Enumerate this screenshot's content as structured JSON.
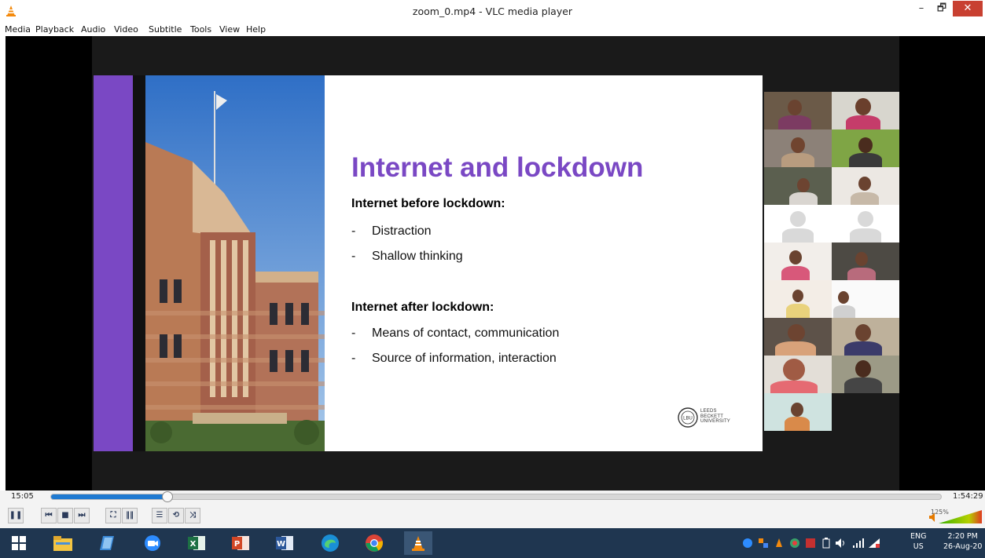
{
  "window": {
    "title": "zoom_0.mp4 - VLC media player",
    "minimize": "–",
    "restore": "🗗",
    "close": "✕"
  },
  "menu": [
    "Media",
    "Playback",
    "Audio",
    "Video",
    "Subtitle",
    "Tools",
    "View",
    "Help"
  ],
  "slide": {
    "heading": "Internet and lockdown",
    "before_title": "Internet before lockdown:",
    "before_items": [
      "Distraction",
      "Shallow thinking"
    ],
    "after_title": "Internet after lockdown:",
    "after_items": [
      "Means of contact, communication",
      "Source of information, interaction"
    ],
    "bullet_dash": "-",
    "logo_lines": [
      "LEEDS",
      "BECKETT",
      "UNIVERSITY"
    ],
    "logo_mark": "LBU"
  },
  "playback": {
    "current_time": "15:05",
    "total_time": "1:54:29",
    "progress": 0.131,
    "volume_label": "125%"
  },
  "controls": {
    "pause": "❚❚",
    "prev": "⏮",
    "stop": "■",
    "next": "⏭",
    "fullscreen": "⛶",
    "extended": "‖‖",
    "playlist": "☰",
    "loop": "⟲",
    "shuffle": "⤨"
  },
  "taskbar": {
    "apps": [
      "start",
      "file-explorer",
      "onenote",
      "zoom",
      "excel",
      "powerpoint",
      "word",
      "edge",
      "chrome",
      "vlc"
    ],
    "lang_top": "ENG",
    "lang_bottom": "US",
    "time": "2:20 PM",
    "date": "26-Aug-20"
  }
}
